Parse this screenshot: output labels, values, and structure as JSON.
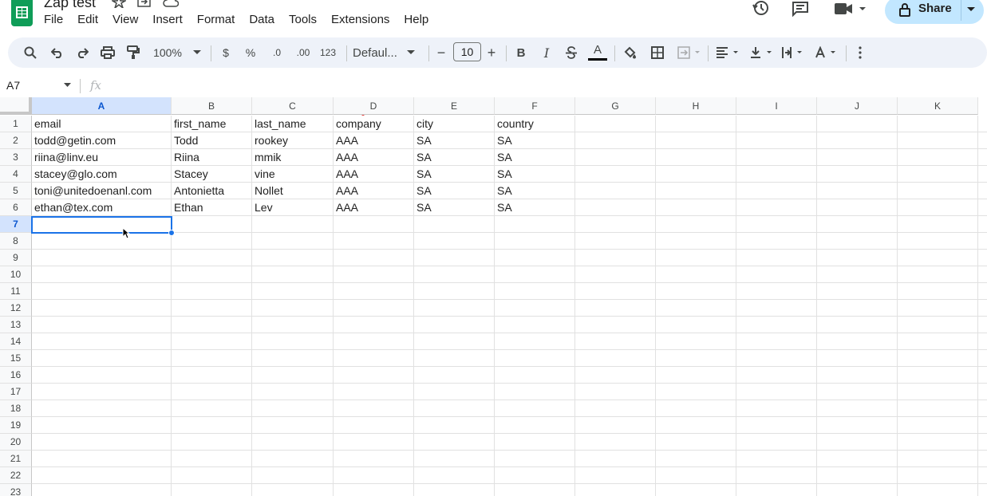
{
  "app": {
    "doc_title": "Zap test",
    "brand_color": "#0f9d58",
    "menu": [
      "File",
      "Edit",
      "View",
      "Insert",
      "Format",
      "Data",
      "Tools",
      "Extensions",
      "Help"
    ],
    "share_label": "Share",
    "share_color": "#c2e7ff"
  },
  "toolbar": {
    "zoom": "100%",
    "currency": "$",
    "percent": "%",
    "dec_decrease": ".0",
    "dec_increase": ".00",
    "number_format": "123",
    "font": "Defaul...",
    "minus": "−",
    "font_size": "10",
    "plus": "+",
    "bold": "B",
    "italic": "I",
    "text_color": "A"
  },
  "formula_bar": {
    "cell_ref": "A7",
    "fx": "fx",
    "value": ""
  },
  "sheet": {
    "columns": [
      "A",
      "B",
      "C",
      "D",
      "E",
      "F",
      "G",
      "H",
      "I",
      "J",
      "K"
    ],
    "selected_column": "A",
    "selected_row": "7",
    "rows": [
      [
        "email",
        "first_name",
        "last_name",
        "company",
        "city",
        "country"
      ],
      [
        "todd@getin.com",
        "Todd",
        "rookey",
        "AAA",
        "SA",
        "SA"
      ],
      [
        "riina@linv.eu",
        "Riina",
        "mmik",
        "AAA",
        "SA",
        "SA"
      ],
      [
        "stacey@glo.com",
        "Stacey",
        "vine",
        "AAA",
        "SA",
        "SA"
      ],
      [
        "toni@unitedoenanl.com",
        "Antonietta",
        "Nollet",
        "AAA",
        "SA",
        "SA"
      ],
      [
        "ethan@tex.com",
        "Ethan",
        "Lev",
        "AAA",
        "SA",
        "SA"
      ]
    ],
    "row_numbers": [
      "1",
      "2",
      "3",
      "4",
      "5",
      "6",
      "7",
      "8",
      "9",
      "10",
      "11",
      "12",
      "13",
      "14",
      "15",
      "16",
      "17",
      "18",
      "19",
      "20",
      "21",
      "22",
      "23"
    ]
  }
}
